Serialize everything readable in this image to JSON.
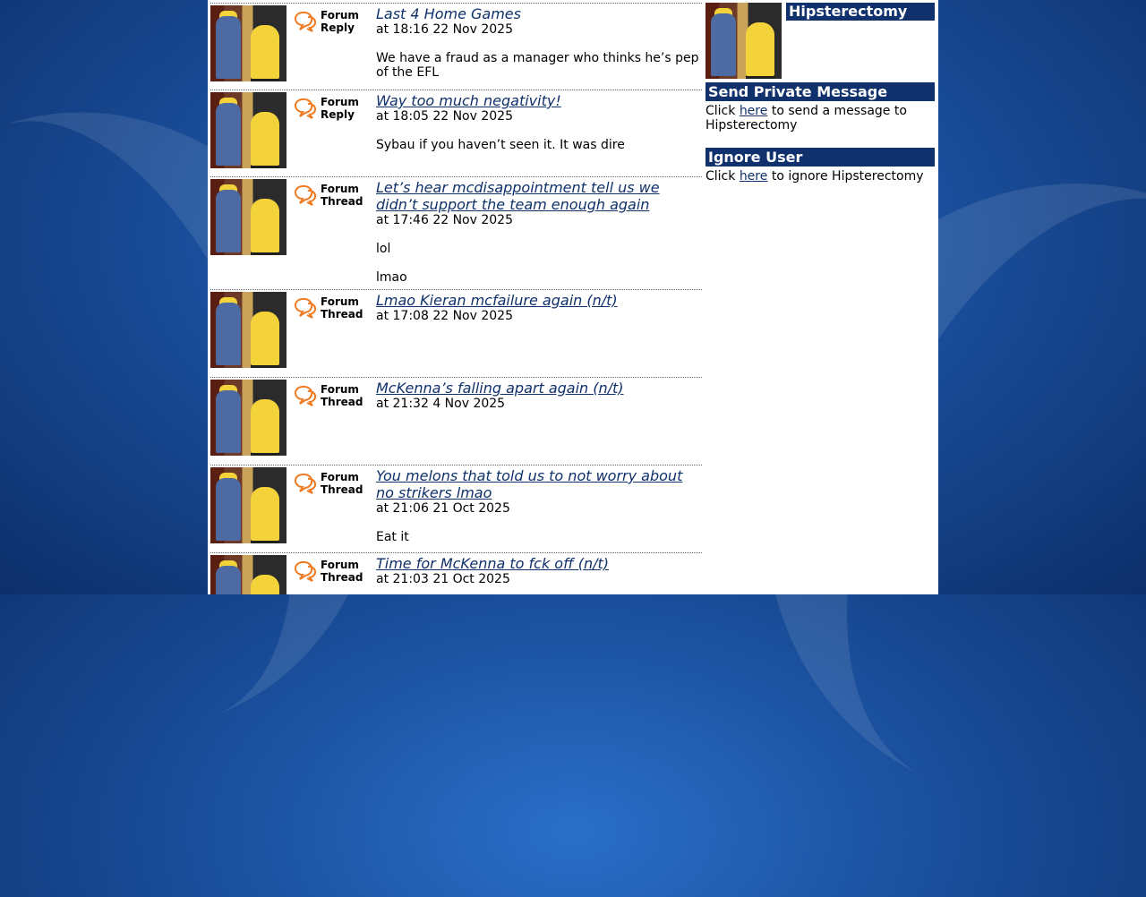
{
  "posts": [
    {
      "type_line1": "Forum",
      "type_line2": "Reply",
      "title": "Last 4 Home Games",
      "underlined": false,
      "time": "at 18:16 22 Nov 2025",
      "body": [
        "We have a fraud as a manager who thinks he’s pep of the EFL"
      ]
    },
    {
      "type_line1": "Forum",
      "type_line2": "Reply",
      "title": "Way too much negativity!",
      "underlined": true,
      "time": "at 18:05 22 Nov 2025",
      "body": [
        "Sybau if you haven’t seen it. It was dire"
      ]
    },
    {
      "type_line1": "Forum",
      "type_line2": "Thread",
      "title": "Let’s hear mcdisappointment tell us we didn’t support the team enough again",
      "underlined": true,
      "time": "at 17:46 22 Nov 2025",
      "body": [
        "lol",
        "lmao"
      ]
    },
    {
      "type_line1": "Forum",
      "type_line2": "Thread",
      "title": "Lmao Kieran mcfailure again (n/t)",
      "underlined": true,
      "time": "at 17:08 22 Nov 2025",
      "body": []
    },
    {
      "type_line1": "Forum",
      "type_line2": "Thread",
      "title": "McKenna’s falling apart again (n/t)",
      "underlined": true,
      "time": "at 21:32 4 Nov 2025",
      "body": []
    },
    {
      "type_line1": "Forum",
      "type_line2": "Thread",
      "title": "You melons that told us to not worry about no strikers lmao",
      "underlined": true,
      "time": "at 21:06 21 Oct 2025",
      "body": [
        "Eat it"
      ]
    },
    {
      "type_line1": "Forum",
      "type_line2": "Thread",
      "title": "Time for McKenna to fck off (n/t)",
      "underlined": true,
      "time": "at 21:03 21 Oct 2025",
      "body": []
    }
  ],
  "sidebar": {
    "username": "Hipsterectomy",
    "pm_heading": "Send Private Message",
    "pm_text_before": "Click",
    "pm_link": "here",
    "pm_text_after": "to send a message to Hipsterectomy",
    "ignore_heading": "Ignore User",
    "ignore_text_before": "Click",
    "ignore_link": "here",
    "ignore_text_after": "to ignore Hipsterectomy"
  },
  "colors": {
    "accent_navy": "#10316b",
    "icon_orange": "#f07a22"
  },
  "icons": {
    "post_type": "speech-bubbles-icon"
  }
}
